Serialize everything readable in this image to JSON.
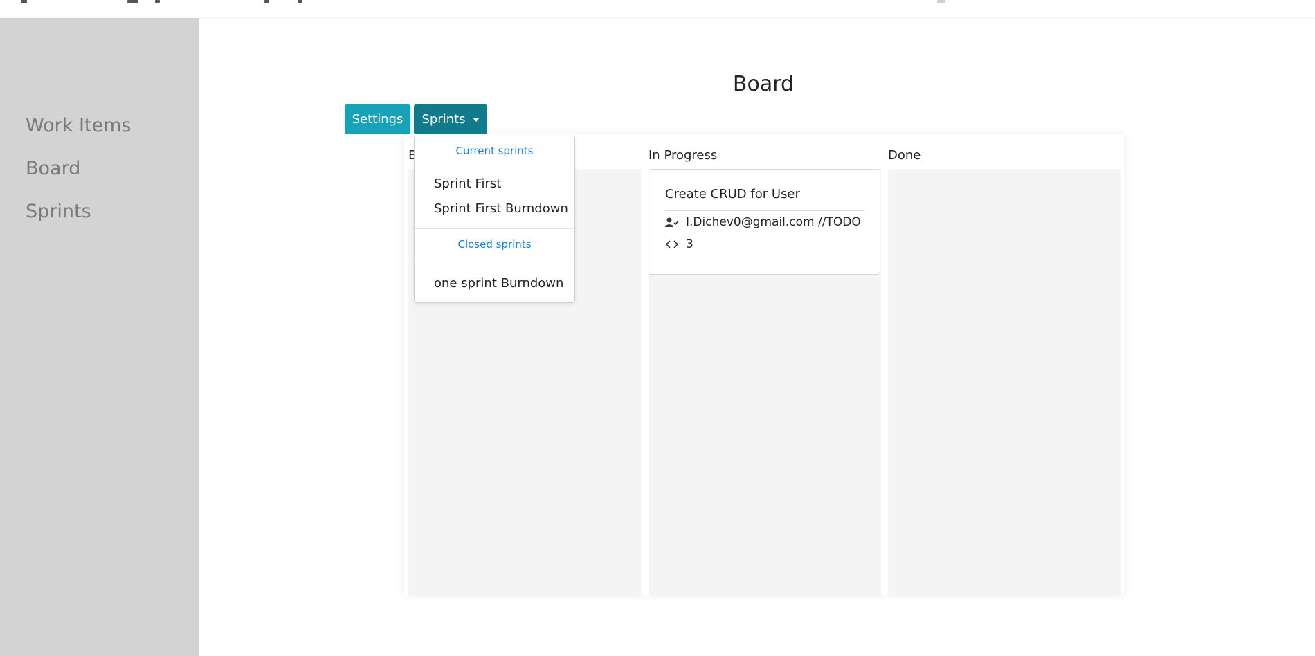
{
  "sidebar": {
    "items": [
      {
        "label": "Work Items"
      },
      {
        "label": "Board"
      },
      {
        "label": "Sprints"
      }
    ]
  },
  "page": {
    "title": "Board"
  },
  "toolbar": {
    "settings_label": "Settings",
    "sprints_label": "Sprints"
  },
  "sprints_dropdown": {
    "current_header": "Current sprints",
    "current_items": [
      "Sprint First",
      "Sprint First Burndown"
    ],
    "closed_header": "Closed sprints",
    "closed_items": [
      "one sprint Burndown"
    ]
  },
  "board": {
    "columns": [
      {
        "title": "B"
      },
      {
        "title": "In Progress"
      },
      {
        "title": "Done"
      }
    ],
    "cards": [
      {
        "title": "Create CRUD for User",
        "assignee": "I.Dichev0@gmail.com //TODO",
        "estimate": "3",
        "assignee_icon": "user-check-icon",
        "estimate_icon": "code-icon"
      }
    ]
  },
  "colors": {
    "sidebar_bg": "#d3d3d3",
    "settings_button": "#17a2b8",
    "sprints_button": "#117a8b",
    "dropdown_header": "#1a7fd6",
    "column_bg": "#f4f4f4"
  }
}
